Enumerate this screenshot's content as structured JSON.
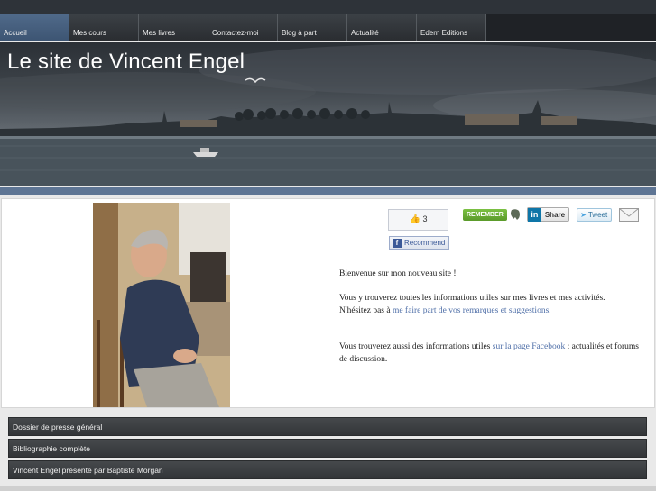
{
  "nav": {
    "items": [
      {
        "label": "Accueil",
        "active": true
      },
      {
        "label": "Mes cours"
      },
      {
        "label": "Mes livres"
      },
      {
        "label": "Contactez-moi"
      },
      {
        "label": "Blog à part"
      },
      {
        "label": "Actualité"
      },
      {
        "label": "Edern Editions"
      }
    ]
  },
  "banner": {
    "title": "Le site de Vincent Engel"
  },
  "social": {
    "like_count": "3",
    "recommend_label": "Recommend",
    "remember_label": "REMEMBER",
    "linkedin_label": "Share",
    "twitter_label": "Tweet"
  },
  "content": {
    "welcome": "Bienvenue sur mon nouveau site !",
    "intro": "Vous y trouverez toutes les informations utiles sur mes livres et mes activités.",
    "contact_prefix": "N'hésitez pas à ",
    "contact_link": "me faire part de vos remarques et suggestions",
    "contact_suffix": ".",
    "facebook_prefix": "Vous trouverez aussi des informations utiles ",
    "facebook_link": "sur la page Facebook",
    "facebook_suffix": " : actualités et forums de discussion."
  },
  "links": [
    "Dossier de presse général",
    "Bibliographie complète",
    "Vincent Engel présenté par Baptiste Morgan"
  ],
  "colors": {
    "nav_active": "#506a8a",
    "link": "#4f6fa8",
    "separator": "#5e7594"
  }
}
